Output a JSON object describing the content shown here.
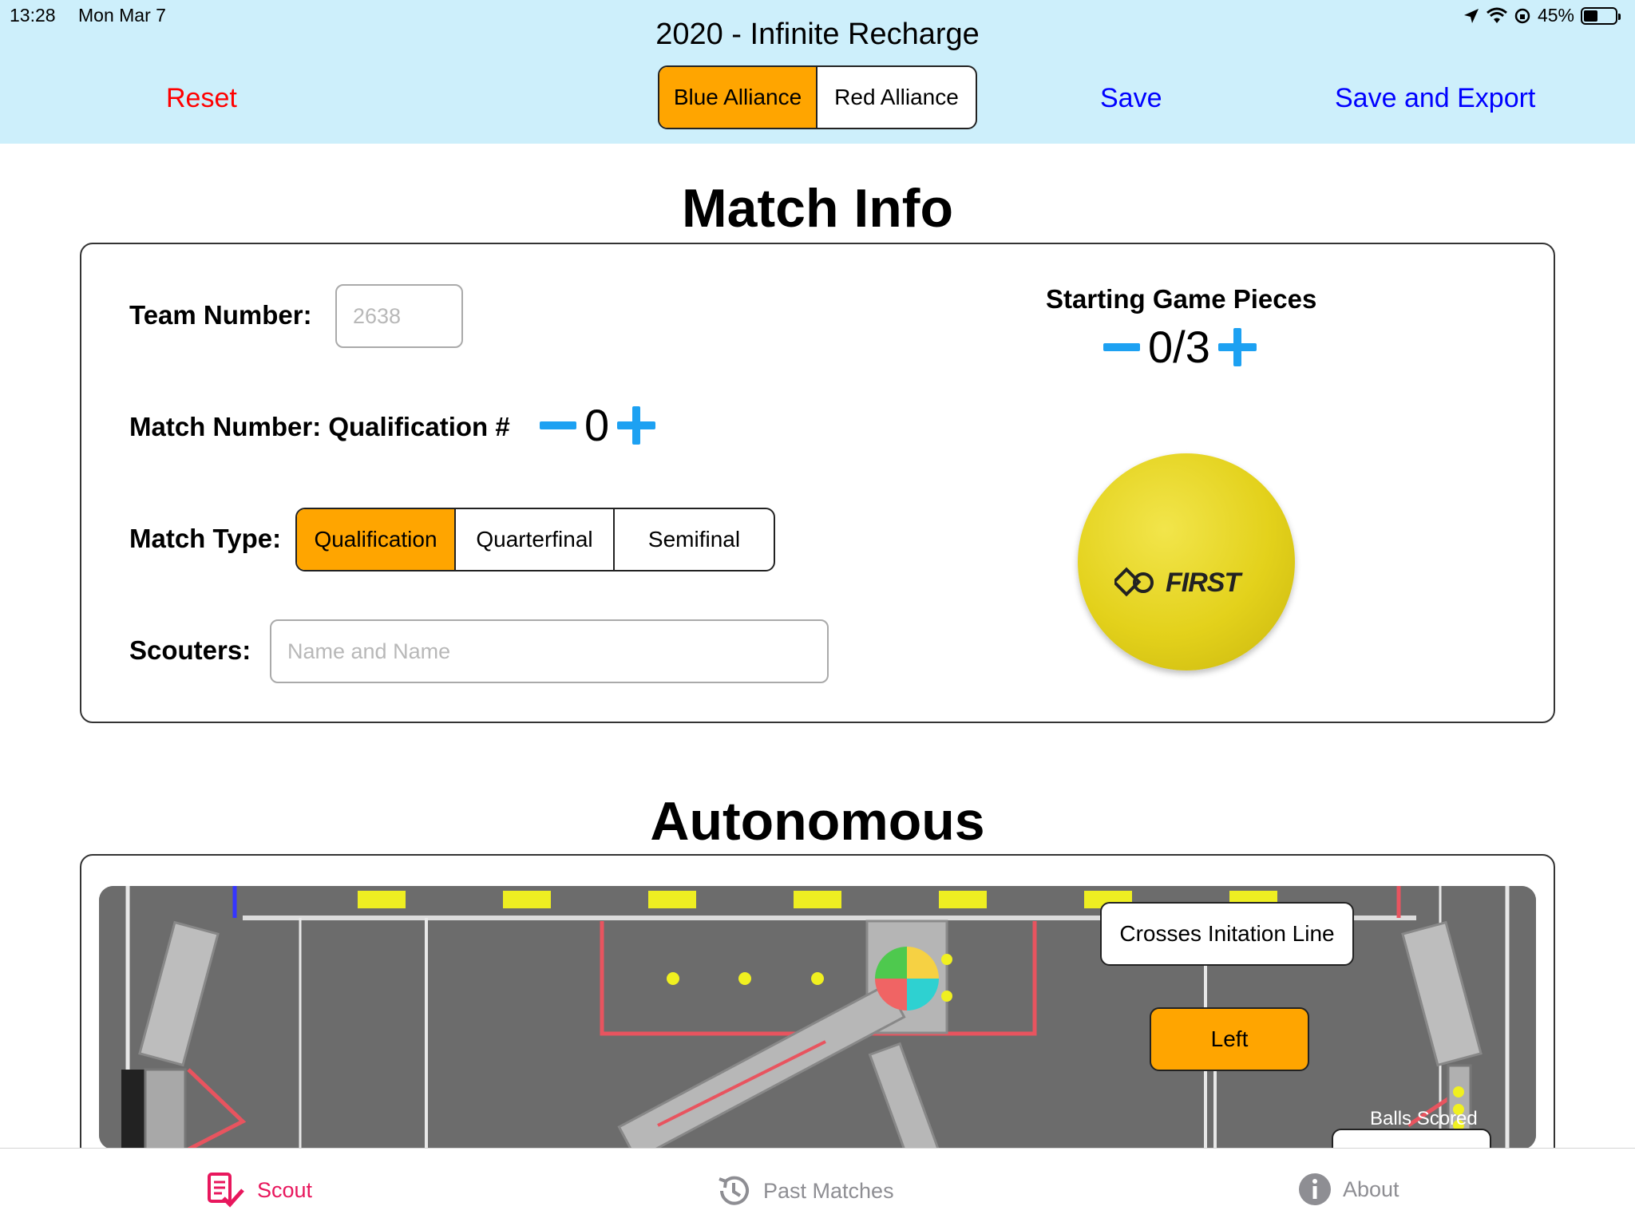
{
  "status_bar": {
    "time": "13:28",
    "date": "Mon Mar 7",
    "battery": "45%",
    "battery_level": 0.45
  },
  "header": {
    "title": "2020 - Infinite Recharge",
    "reset_label": "Reset",
    "save_label": "Save",
    "save_export_label": "Save and Export",
    "alliance": {
      "options": [
        "Blue Alliance",
        "Red Alliance"
      ],
      "selected": "Blue Alliance"
    }
  },
  "match_info": {
    "title": "Match Info",
    "team_number": {
      "label": "Team Number:",
      "placeholder": "2638"
    },
    "match_number": {
      "label": "Match Number: Qualification #",
      "value": "0"
    },
    "match_type": {
      "label": "Match Type:",
      "options": [
        "Qualification",
        "Quarterfinal",
        "Semifinal"
      ],
      "selected": "Qualification"
    },
    "scouters": {
      "label": "Scouters:",
      "placeholder": "Name and Name"
    },
    "starting_pieces": {
      "label": "Starting Game Pieces",
      "value": "0/3"
    },
    "ball_logo": "FIRST"
  },
  "autonomous": {
    "title": "Autonomous",
    "crosses_line_label": "Crosses Initation Line",
    "start_position_label": "Left",
    "balls_scored_label": "Balls Scored"
  },
  "tabs": [
    {
      "label": "Scout",
      "icon": "scout-checklist-icon",
      "active": true
    },
    {
      "label": "Past Matches",
      "icon": "history-icon",
      "active": false
    },
    {
      "label": "About",
      "icon": "info-icon",
      "active": false
    }
  ],
  "colors": {
    "selected": "#ffa500",
    "accent": "#1da1f2",
    "link": "#0000ff",
    "reset": "#ff0000",
    "active_tab": "#e8175d",
    "header_bg": "#cdeffb"
  }
}
